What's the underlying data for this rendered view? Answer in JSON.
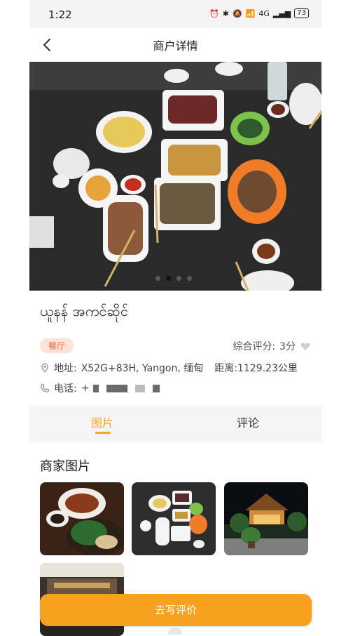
{
  "status_bar": {
    "time": "1:22",
    "battery": "73",
    "network": "4G"
  },
  "header": {
    "title": "商户详情"
  },
  "carousel": {
    "total_slides": 4,
    "active_index": 1
  },
  "merchant": {
    "name": "ယူနန် အကင်ဆိုင်",
    "category": "餐厅",
    "rating_label": "综合评分:",
    "rating_value": "3分",
    "address_label": "地址:",
    "address_value": "X52G+83H, Yangon, 缅甸",
    "distance": "距离:1129.23公里",
    "phone_label": "电话:",
    "phone_value": "+"
  },
  "tabs": [
    {
      "label": "图片"
    },
    {
      "label": "评论"
    }
  ],
  "gallery": {
    "title": "商家图片",
    "photos": [
      {
        "subject": "plates of grilled meat and greens on a table"
      },
      {
        "subject": "table with many dishes"
      },
      {
        "subject": "restaurant building at night"
      },
      {
        "subject": "restaurant interior"
      }
    ]
  },
  "actions": {
    "write_review": "去写评价"
  },
  "colors": {
    "accent": "#f5a623",
    "badge_bg": "#fde3d8",
    "badge_text": "#ef6a3a"
  }
}
